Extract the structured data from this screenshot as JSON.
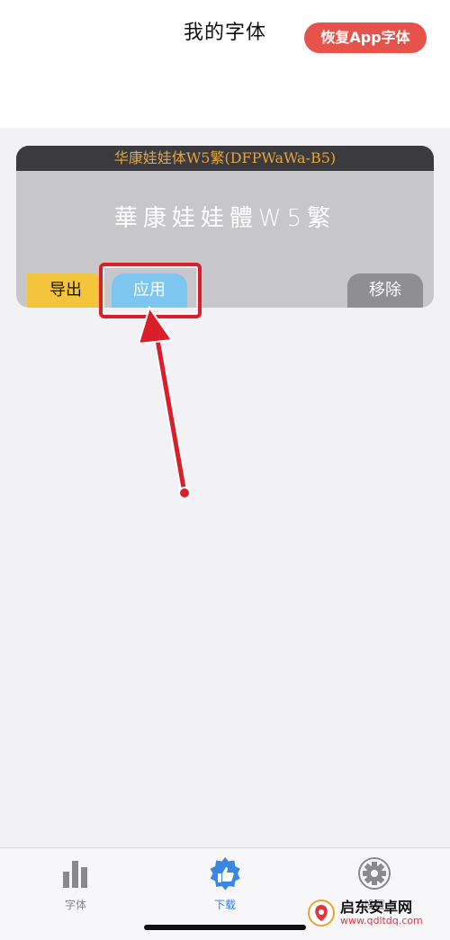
{
  "header": {
    "title": "我的字体",
    "restore_button": "恢复App字体"
  },
  "font_card": {
    "name": "华康娃娃体W5繁(DFPWaWa-B5)",
    "preview_text": "華康娃娃體W5繁",
    "export_label": "导出",
    "apply_label": "应用",
    "remove_label": "移除"
  },
  "tabs": [
    {
      "label": "字体",
      "icon": "bar-chart-icon",
      "active": false
    },
    {
      "label": "下载",
      "icon": "thumbs-up-icon",
      "active": true
    },
    {
      "label": "设置",
      "icon": "gear-icon",
      "active": false
    }
  ],
  "watermark": {
    "name": "启东安卓网",
    "url": "www.qdltdq.com"
  },
  "colors": {
    "accent_red": "#e5534b",
    "export_yellow": "#f3c43c",
    "apply_blue": "#7cc6f0",
    "remove_gray": "#8e8e93",
    "header_orange": "#e5a53a",
    "annotation_red": "#d81f2a"
  }
}
